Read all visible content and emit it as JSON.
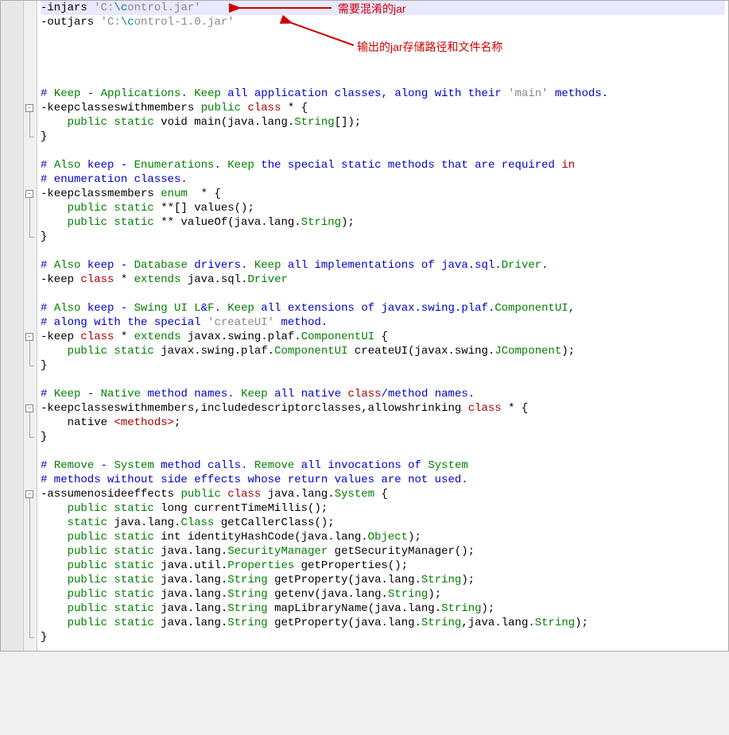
{
  "annotations": {
    "anno1": "需要混淆的jar",
    "anno2": "输出的jar存储路径和文件名称"
  },
  "lines": [
    {
      "html": "<span class='black'>-injars </span><span class='str-grey'>'C:</span><span class='teal'>\\c</span><span class='str-grey'>ontrol.jar'</span>",
      "hl": true
    },
    {
      "html": "<span class='black'>-outjars </span><span class='str-grey'>'C:</span><span class='teal'>\\c</span><span class='str-grey'>ontrol-1.0.jar'</span>"
    },
    {
      "html": ""
    },
    {
      "html": ""
    },
    {
      "html": ""
    },
    {
      "html": ""
    },
    {
      "html": "<span class='kw-blue'># </span><span class='kw-green'>Keep</span><span class='kw-blue'> - </span><span class='kw-green'>Applications</span><span class='kw-blue'>. </span><span class='kw-green'>Keep</span><span class='kw-blue'> all application classes, along with their </span><span class='str-grey'>'main'</span><span class='kw-blue'> methods.</span>"
    },
    {
      "html": "<span class='black'>-keepclasseswithmembers </span><span class='kw-green'>public</span><span class='black'> </span><span class='kw-red'>class</span><span class='black'> * {</span>",
      "fold": "start"
    },
    {
      "html": "    <span class='kw-green'>public static</span><span class='black'> void main(java.lang.</span><span class='kw-green'>String</span><span class='black'>[]);</span>"
    },
    {
      "html": "<span class='black'>}</span>",
      "fold": "end"
    },
    {
      "html": ""
    },
    {
      "html": "<span class='kw-blue'># </span><span class='kw-green'>Also</span><span class='kw-blue'> keep - </span><span class='kw-green'>Enumerations</span><span class='kw-blue'>. </span><span class='kw-green'>Keep</span><span class='kw-blue'> the special static methods that are required </span><span class='kw-red'>in</span>"
    },
    {
      "html": "<span class='kw-blue'># enumeration classes.</span>"
    },
    {
      "html": "<span class='black'>-keepclassmembers </span><span class='kw-green'>enum</span><span class='black'>  * {</span>",
      "fold": "start"
    },
    {
      "html": "    <span class='kw-green'>public static</span><span class='black'> **[] values();</span>"
    },
    {
      "html": "    <span class='kw-green'>public static</span><span class='black'> ** valueOf(java.lang.</span><span class='kw-green'>String</span><span class='black'>);</span>"
    },
    {
      "html": "<span class='black'>}</span>",
      "fold": "end"
    },
    {
      "html": ""
    },
    {
      "html": "<span class='kw-blue'># </span><span class='kw-green'>Also</span><span class='kw-blue'> keep - </span><span class='kw-green'>Database</span><span class='kw-blue'> drivers. </span><span class='kw-green'>Keep</span><span class='kw-blue'> all implementations of java.sql.</span><span class='kw-green'>Driver</span><span class='kw-blue'>.</span>"
    },
    {
      "html": "<span class='black'>-keep </span><span class='kw-red'>class</span><span class='black'> * </span><span class='kw-green'>extends</span><span class='black'> java.sql.</span><span class='kw-green'>Driver</span>"
    },
    {
      "html": ""
    },
    {
      "html": "<span class='kw-blue'># </span><span class='kw-green'>Also</span><span class='kw-blue'> keep - </span><span class='kw-green'>Swing UI L</span><span class='kw-blue'>&amp;</span><span class='kw-green'>F</span><span class='kw-blue'>. </span><span class='kw-green'>Keep</span><span class='kw-blue'> all extensions of javax.swing.plaf.</span><span class='kw-green'>ComponentUI</span><span class='kw-blue'>,</span>"
    },
    {
      "html": "<span class='kw-blue'># along with the special </span><span class='str-grey'>'createUI'</span><span class='kw-blue'> method.</span>"
    },
    {
      "html": "<span class='black'>-keep </span><span class='kw-red'>class</span><span class='black'> * </span><span class='kw-green'>extends</span><span class='black'> javax.swing.plaf.</span><span class='kw-green'>ComponentUI</span><span class='black'> {</span>",
      "fold": "start"
    },
    {
      "html": "    <span class='kw-green'>public static</span><span class='black'> javax.swing.plaf.</span><span class='kw-green'>ComponentUI</span><span class='black'> createUI(javax.swing.</span><span class='kw-green'>JComponent</span><span class='black'>);</span>"
    },
    {
      "html": "<span class='black'>}</span>",
      "fold": "end"
    },
    {
      "html": ""
    },
    {
      "html": "<span class='kw-blue'># </span><span class='kw-green'>Keep</span><span class='kw-blue'> - </span><span class='kw-green'>Native</span><span class='kw-blue'> method names. </span><span class='kw-green'>Keep</span><span class='kw-blue'> all native </span><span class='kw-red'>class</span><span class='kw-blue'>/method names.</span>"
    },
    {
      "html": "<span class='black'>-keepclasseswithmembers,includedescriptorclasses,allowshrinking </span><span class='kw-red'>class</span><span class='black'> * {</span>",
      "fold": "start"
    },
    {
      "html": "    <span class='black'>native </span><span class='tag-red'>&lt;methods&gt;</span><span class='black'>;</span>"
    },
    {
      "html": "<span class='black'>}</span>",
      "fold": "end"
    },
    {
      "html": ""
    },
    {
      "html": "<span class='kw-blue'># </span><span class='kw-green'>Remove</span><span class='kw-blue'> - </span><span class='kw-green'>System</span><span class='kw-blue'> method calls. </span><span class='kw-green'>Remove</span><span class='kw-blue'> all invocations of </span><span class='kw-green'>System</span>"
    },
    {
      "html": "<span class='kw-blue'># methods without side effects whose return values are not used.</span>"
    },
    {
      "html": "<span class='black'>-assumenosideeffects </span><span class='kw-green'>public</span><span class='black'> </span><span class='kw-red'>class</span><span class='black'> java.lang.</span><span class='kw-green'>System</span><span class='black'> {</span>",
      "fold": "start"
    },
    {
      "html": "    <span class='kw-green'>public static</span><span class='black'> long currentTimeMillis();</span>"
    },
    {
      "html": "    <span class='kw-green'>static</span><span class='black'> java.lang.</span><span class='kw-green'>Class</span><span class='black'> getCallerClass();</span>"
    },
    {
      "html": "    <span class='kw-green'>public static</span><span class='black'> int identityHashCode(java.lang.</span><span class='kw-green'>Object</span><span class='black'>);</span>"
    },
    {
      "html": "    <span class='kw-green'>public static</span><span class='black'> java.lang.</span><span class='kw-green'>SecurityManager</span><span class='black'> getSecurityManager();</span>"
    },
    {
      "html": "    <span class='kw-green'>public static</span><span class='black'> java.util.</span><span class='kw-green'>Properties</span><span class='black'> getProperties();</span>"
    },
    {
      "html": "    <span class='kw-green'>public static</span><span class='black'> java.lang.</span><span class='kw-green'>String</span><span class='black'> getProperty(java.lang.</span><span class='kw-green'>String</span><span class='black'>);</span>"
    },
    {
      "html": "    <span class='kw-green'>public static</span><span class='black'> java.lang.</span><span class='kw-green'>String</span><span class='black'> getenv(java.lang.</span><span class='kw-green'>String</span><span class='black'>);</span>"
    },
    {
      "html": "    <span class='kw-green'>public static</span><span class='black'> java.lang.</span><span class='kw-green'>String</span><span class='black'> mapLibraryName(java.lang.</span><span class='kw-green'>String</span><span class='black'>);</span>"
    },
    {
      "html": "    <span class='kw-green'>public static</span><span class='black'> java.lang.</span><span class='kw-green'>String</span><span class='black'> getProperty(java.lang.</span><span class='kw-green'>String</span><span class='black'>,java.lang.</span><span class='kw-green'>String</span><span class='black'>);</span>"
    },
    {
      "html": "<span class='black'>}</span>",
      "fold": "end"
    }
  ]
}
